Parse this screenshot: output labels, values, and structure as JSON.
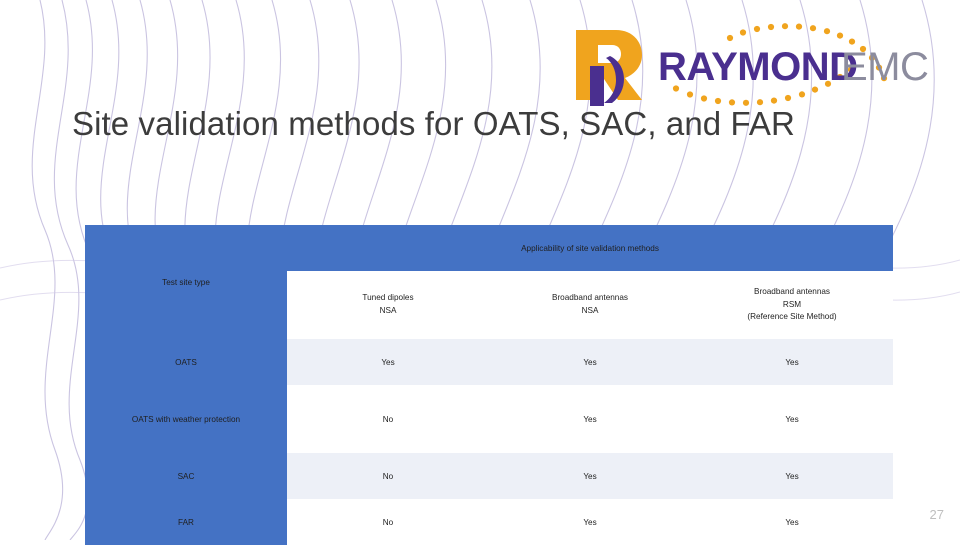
{
  "slide": {
    "title": "Site validation methods for OATS, SAC, and FAR",
    "page_number": "27",
    "brand_colors": {
      "header_blue": "#4472c4",
      "cell_light": "#edf0f7",
      "logo_orange": "#f0a41e",
      "logo_purple": "#4a2f8f",
      "logo_gray": "#8c8c9e",
      "wave_purple": "#b9b1d8"
    }
  },
  "logo": {
    "mark": "R",
    "word_primary": "RAYMOND",
    "word_secondary": "EMC"
  },
  "table": {
    "corner_label": "Test site type",
    "group_header": "Applicability of site validation methods",
    "columns": [
      {
        "line1": "Tuned dipoles",
        "line2": "NSA",
        "line3": ""
      },
      {
        "line1": "Broadband antennas",
        "line2": "NSA",
        "line3": ""
      },
      {
        "line1": "Broadband antennas",
        "line2": "RSM",
        "line3": "(Reference Site Method)"
      }
    ],
    "rows": [
      {
        "label": "OATS",
        "values": [
          "Yes",
          "Yes",
          "Yes"
        ]
      },
      {
        "label": "OATS with weather protection",
        "values": [
          "No",
          "Yes",
          "Yes"
        ]
      },
      {
        "label": "SAC",
        "values": [
          "No",
          "Yes",
          "Yes"
        ]
      },
      {
        "label": "FAR",
        "values": [
          "No",
          "Yes",
          "Yes"
        ]
      }
    ]
  }
}
